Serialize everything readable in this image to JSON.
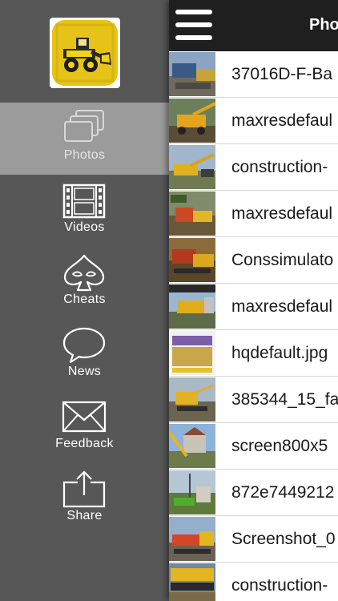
{
  "sidebar": {
    "items": [
      {
        "label": "Photos",
        "icon": "photos-icon",
        "active": true
      },
      {
        "label": "Videos",
        "icon": "film-icon",
        "active": false
      },
      {
        "label": "Cheats",
        "icon": "spade-icon",
        "active": false
      },
      {
        "label": "News",
        "icon": "speech-bubble-icon",
        "active": false
      },
      {
        "label": "Feedback",
        "icon": "envelope-icon",
        "active": false
      },
      {
        "label": "Share",
        "icon": "share-icon",
        "active": false
      }
    ]
  },
  "navbar": {
    "title": "Photos",
    "menu_icon": "hamburger-icon"
  },
  "photos": [
    {
      "name": "37016D-F-Ba"
    },
    {
      "name": "maxresdefaul"
    },
    {
      "name": "construction-"
    },
    {
      "name": "maxresdefaul"
    },
    {
      "name": "Conssimulato"
    },
    {
      "name": "maxresdefaul"
    },
    {
      "name": "hqdefault.jpg"
    },
    {
      "name": "385344_15_fa"
    },
    {
      "name": "screen800x5"
    },
    {
      "name": "872e7449212"
    },
    {
      "name": "Screenshot_0"
    },
    {
      "name": "construction-"
    }
  ],
  "colors": {
    "sidebar_bg": "#575757",
    "sidebar_active": "#9b9b9b",
    "navbar_bg": "#1f1f1f",
    "logo_yellow": "#e6c318"
  }
}
